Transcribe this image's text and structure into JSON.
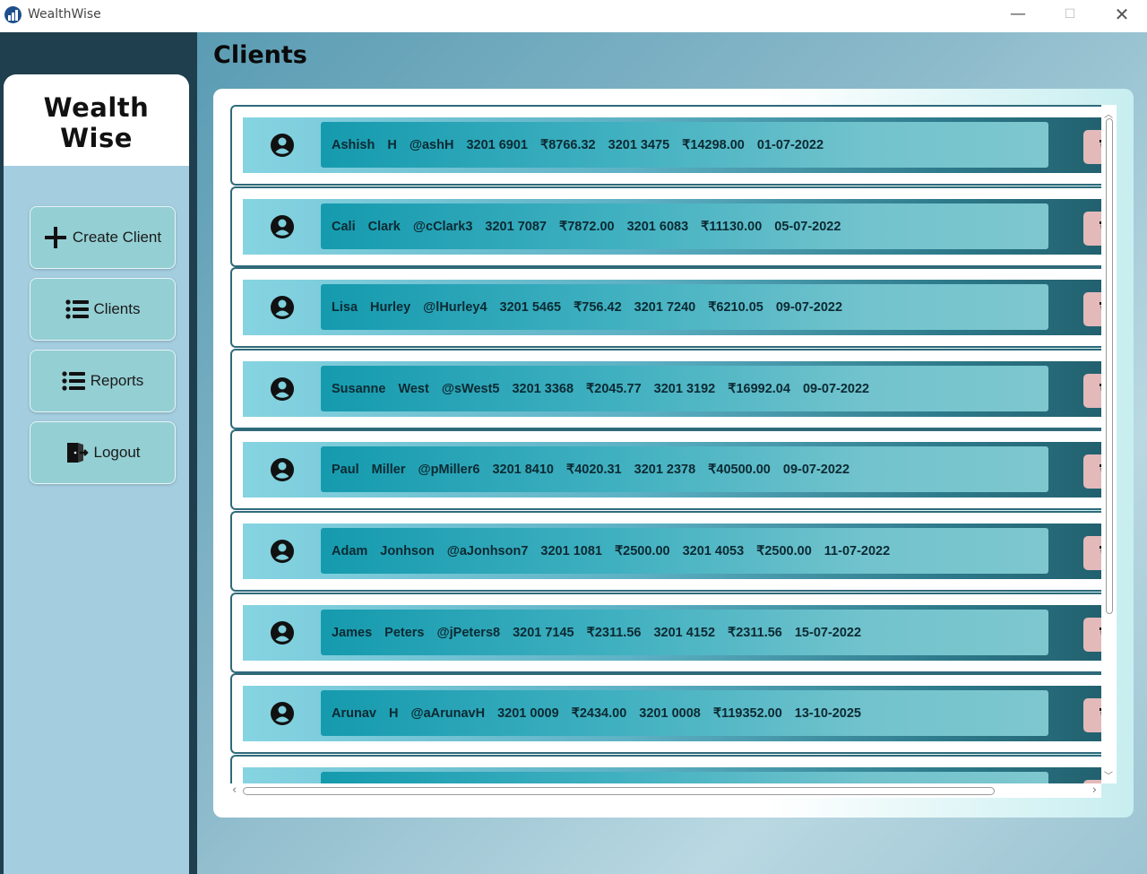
{
  "window": {
    "title": "WealthWise",
    "minimize_glyph": "—",
    "maximize_glyph": "☐",
    "close_glyph": "✕"
  },
  "sidebar": {
    "logo": "Wealth Wise",
    "items": [
      {
        "label": "Create Client",
        "icon": "plus-icon"
      },
      {
        "label": "Clients",
        "icon": "list-icon"
      },
      {
        "label": "Reports",
        "icon": "list-icon"
      },
      {
        "label": "Logout",
        "icon": "door-exit-icon"
      }
    ]
  },
  "main": {
    "title": "Clients"
  },
  "clients": [
    {
      "first": "Ashish",
      "last": "H",
      "handle": "@ashH",
      "account1": "3201 6901",
      "balance1": "₹8766.32",
      "account2": "3201 3475",
      "balance2": "₹14298.00",
      "date": "01-07-2022"
    },
    {
      "first": "Cali",
      "last": "Clark",
      "handle": "@cClark3",
      "account1": "3201 7087",
      "balance1": "₹7872.00",
      "account2": "3201 6083",
      "balance2": "₹11130.00",
      "date": "05-07-2022"
    },
    {
      "first": "Lisa",
      "last": "Hurley",
      "handle": "@lHurley4",
      "account1": "3201 5465",
      "balance1": "₹756.42",
      "account2": "3201 7240",
      "balance2": "₹6210.05",
      "date": "09-07-2022"
    },
    {
      "first": "Susanne",
      "last": "West",
      "handle": "@sWest5",
      "account1": "3201 3368",
      "balance1": "₹2045.77",
      "account2": "3201 3192",
      "balance2": "₹16992.04",
      "date": "09-07-2022"
    },
    {
      "first": "Paul",
      "last": "Miller",
      "handle": "@pMiller6",
      "account1": "3201 8410",
      "balance1": "₹4020.31",
      "account2": "3201 2378",
      "balance2": "₹40500.00",
      "date": "09-07-2022"
    },
    {
      "first": "Adam",
      "last": "Jonhson",
      "handle": "@aJonhson7",
      "account1": "3201 1081",
      "balance1": "₹2500.00",
      "account2": "3201 4053",
      "balance2": "₹2500.00",
      "date": "11-07-2022"
    },
    {
      "first": "James",
      "last": "Peters",
      "handle": "@jPeters8",
      "account1": "3201 7145",
      "balance1": "₹2311.56",
      "account2": "3201 4152",
      "balance2": "₹2311.56",
      "date": "15-07-2022"
    },
    {
      "first": "Arunav",
      "last": "H",
      "handle": "@aArunavH",
      "account1": "3201 0009",
      "balance1": "₹2434.00",
      "account2": "3201 0008",
      "balance2": "₹119352.00",
      "date": "13-10-2025"
    },
    {
      "first": "",
      "last": "",
      "handle": "",
      "account1": "",
      "balance1": "",
      "account2": "",
      "balance2": "",
      "date": ""
    }
  ],
  "colors": {
    "sidebar_bg": "#a4cee0",
    "nav_button_bg": "#94cfd4",
    "delete_button_bg": "#e4b9b9",
    "row_border": "#2f6a7a",
    "info_strip": "#159aae"
  }
}
